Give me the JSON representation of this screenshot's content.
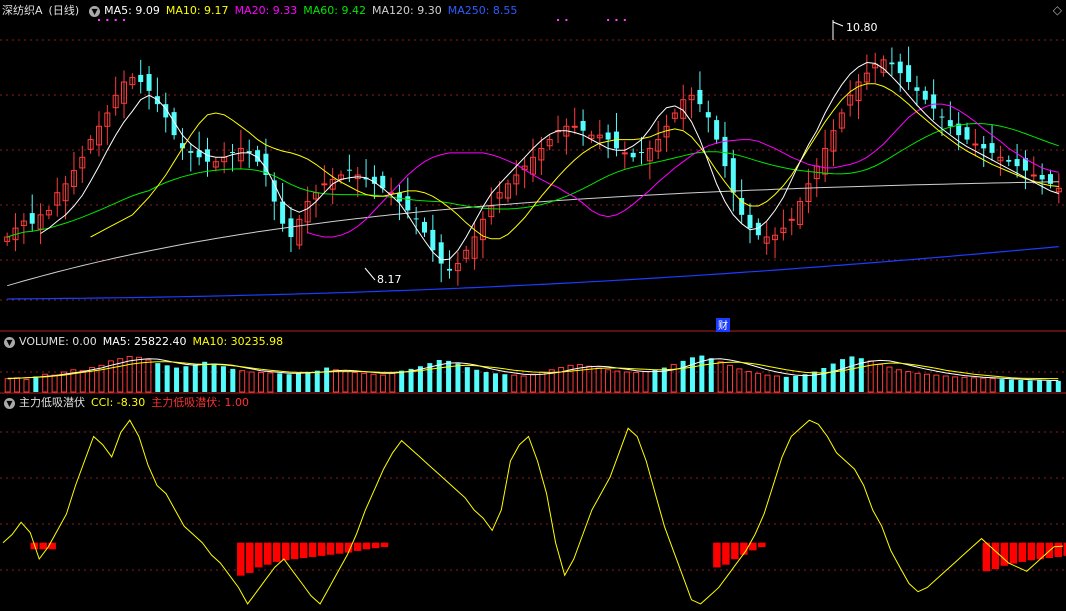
{
  "colors": {
    "up": "#ff3b3b",
    "down": "#54fcfc",
    "ma5": "#ffffff",
    "ma10": "#ffff00",
    "ma20": "#ff00ff",
    "ma60": "#00e600",
    "ma120": "#d0d0d0",
    "ma250": "#1c3cff",
    "cci": "#ffff00",
    "signal": "#ff0000",
    "grid": "#8b1e1e",
    "separator": "#b02020"
  },
  "legend_main": {
    "stock": "深纺织A",
    "period": "(日线)",
    "ma5": "MA5: 9.09",
    "ma10": "MA10: 9.17",
    "ma20": "MA20: 9.33",
    "ma60": "MA60: 9.42",
    "ma120": "MA120: 9.30",
    "ma250": "MA250: 8.55"
  },
  "legend_volume": {
    "name": "VOLUME: 0.00",
    "ma5": "MA5: 25822.40",
    "ma10": "MA10: 30235.98"
  },
  "legend_indicator": {
    "name": "主力低吸潜伏",
    "cci": "CCI: -8.30",
    "signal": "主力低吸潜伏: 1.00"
  },
  "annotations": {
    "high": "10.80",
    "low": "8.17",
    "event": "财"
  },
  "chart_data": [
    {
      "type": "candlestick",
      "panel": "price",
      "title": "深纺织A (日线)",
      "ylim": [
        7.55,
        11.05
      ],
      "close": [
        8.6,
        8.7,
        8.78,
        8.75,
        8.85,
        8.9,
        9.1,
        9.2,
        9.35,
        9.5,
        9.7,
        9.85,
        10.0,
        10.2,
        10.35,
        10.4,
        10.35,
        10.25,
        10.1,
        9.95,
        9.75,
        9.6,
        9.55,
        9.5,
        9.45,
        9.45,
        9.5,
        9.55,
        9.6,
        9.55,
        9.45,
        9.3,
        9.0,
        8.75,
        8.6,
        8.8,
        9.0,
        9.1,
        9.2,
        9.25,
        9.3,
        9.35,
        9.3,
        9.25,
        9.2,
        9.15,
        9.1,
        9.0,
        8.9,
        8.8,
        8.65,
        8.45,
        8.3,
        8.22,
        8.3,
        8.45,
        8.6,
        8.8,
        8.95,
        9.1,
        9.2,
        9.3,
        9.4,
        9.5,
        9.6,
        9.7,
        9.8,
        9.85,
        9.85,
        9.8,
        9.75,
        9.75,
        9.7,
        9.6,
        9.55,
        9.5,
        9.55,
        9.6,
        9.7,
        9.85,
        10.0,
        10.15,
        10.2,
        10.1,
        9.95,
        9.7,
        9.4,
        9.1,
        8.85,
        8.7,
        8.62,
        8.6,
        8.62,
        8.7,
        8.8,
        9.0,
        9.2,
        9.4,
        9.6,
        9.8,
        10.0,
        10.2,
        10.35,
        10.45,
        10.55,
        10.6,
        10.55,
        10.45,
        10.35,
        10.25,
        10.15,
        10.05,
        9.95,
        9.85,
        9.75,
        9.7,
        9.65,
        9.6,
        9.55,
        9.5,
        9.45,
        9.4,
        9.35,
        9.3,
        9.25,
        9.2,
        9.15
      ],
      "ma": {
        "ma5": [
          8.64,
          8.7,
          8.78,
          8.85,
          8.95,
          9.07,
          9.23,
          9.4,
          9.58,
          9.75,
          9.9,
          10.02,
          10.15,
          10.2,
          10.15,
          10.05,
          9.9,
          9.75,
          9.65,
          9.58,
          9.52,
          9.5,
          9.5,
          9.53,
          9.55,
          9.55,
          9.5,
          9.38,
          9.2,
          9.0,
          8.92,
          8.88,
          8.92,
          9.0,
          9.1,
          9.2,
          9.25,
          9.27,
          9.28,
          9.27,
          9.22,
          9.15,
          9.07,
          8.98,
          8.85,
          8.7,
          8.56,
          8.43,
          8.34,
          8.35,
          8.45,
          8.6,
          8.77,
          8.94,
          9.09,
          9.2,
          9.3,
          9.4,
          9.5,
          9.6,
          9.69,
          9.76,
          9.8,
          9.8,
          9.78,
          9.75,
          9.7,
          9.65,
          9.6,
          9.58,
          9.58,
          9.63,
          9.7,
          9.82,
          9.96,
          10.06,
          10.08,
          10.03,
          9.9,
          9.7,
          9.45,
          9.2,
          9.0,
          8.85,
          8.75,
          8.68,
          8.7,
          8.78,
          8.9,
          9.05,
          9.25,
          9.45,
          9.64,
          9.8,
          10.0,
          10.17,
          10.32,
          10.44,
          10.52,
          10.57,
          10.56,
          10.5,
          10.41,
          10.31,
          10.2,
          10.09,
          9.99,
          9.9,
          9.82,
          9.75,
          9.68,
          9.62,
          9.57,
          9.52,
          9.47,
          9.42,
          9.37,
          9.32,
          9.27,
          9.22,
          9.17,
          9.12,
          9.09
        ],
        "ma10": [
          8.6,
          8.65,
          8.7,
          8.75,
          8.8,
          8.85,
          8.95,
          9.05,
          9.17,
          9.3,
          9.45,
          9.6,
          9.75,
          9.88,
          9.98,
          10.0,
          9.98,
          9.92,
          9.85,
          9.78,
          9.7,
          9.64,
          9.6,
          9.57,
          9.55,
          9.52,
          9.48,
          9.42,
          9.35,
          9.28,
          9.22,
          9.17,
          9.12,
          9.08,
          9.06,
          9.06,
          9.08,
          9.1,
          9.12,
          9.12,
          9.1,
          9.06,
          9.0,
          8.93,
          8.85,
          8.76,
          8.68,
          8.61,
          8.58,
          8.58,
          8.63,
          8.72,
          8.82,
          8.94,
          9.06,
          9.17,
          9.28,
          9.38,
          9.47,
          9.55,
          9.61,
          9.66,
          9.68,
          9.7,
          9.7,
          9.7,
          9.71,
          9.73,
          9.77,
          9.8,
          9.82,
          9.8,
          9.73,
          9.62,
          9.49,
          9.35,
          9.22,
          9.1,
          9.0,
          8.95,
          8.95,
          9.0,
          9.08,
          9.18,
          9.3,
          9.45,
          9.6,
          9.75,
          9.9,
          10.03,
          10.15,
          10.24,
          10.3,
          10.33,
          10.33,
          10.3,
          10.25,
          10.18,
          10.1,
          10.01,
          9.93,
          9.85,
          9.77,
          9.7,
          9.63,
          9.57,
          9.52,
          9.47,
          9.42,
          9.38,
          9.34,
          9.3,
          9.26,
          9.23,
          9.2,
          9.18,
          9.17
        ],
        "ma20": [
          8.65,
          8.62,
          8.6,
          8.6,
          8.62,
          8.66,
          8.72,
          8.8,
          8.9,
          9.0,
          9.1,
          9.2,
          9.3,
          9.38,
          9.45,
          9.5,
          9.53,
          9.55,
          9.55,
          9.55,
          9.55,
          9.55,
          9.53,
          9.5,
          9.46,
          9.42,
          9.36,
          9.3,
          9.25,
          9.2,
          9.16,
          9.1,
          9.05,
          8.98,
          8.9,
          8.85,
          8.83,
          8.85,
          8.9,
          8.97,
          9.05,
          9.13,
          9.22,
          9.3,
          9.38,
          9.45,
          9.52,
          9.58,
          9.63,
          9.66,
          9.68,
          9.69,
          9.7,
          9.7,
          9.68,
          9.64,
          9.6,
          9.55,
          9.5,
          9.46,
          9.42,
          9.4,
          9.38,
          9.38,
          9.4,
          9.42,
          9.45,
          9.5,
          9.57,
          9.65,
          9.75,
          9.85,
          9.95,
          10.02,
          10.07,
          10.1,
          10.1,
          10.08,
          10.03,
          9.97,
          9.9,
          9.82,
          9.75,
          9.68,
          9.6,
          9.54,
          9.48,
          9.43,
          9.38,
          9.35,
          9.33
        ]
      }
    },
    {
      "type": "bar",
      "panel": "volume",
      "title": "VOLUME",
      "values": [
        30,
        32,
        28,
        35,
        40,
        38,
        45,
        50,
        48,
        55,
        60,
        70,
        75,
        80,
        78,
        72,
        65,
        60,
        55,
        58,
        62,
        68,
        64,
        58,
        52,
        48,
        45,
        44,
        43,
        42,
        40,
        42,
        45,
        48,
        55,
        50,
        46,
        44,
        42,
        40,
        38,
        42,
        48,
        52,
        58,
        65,
        72,
        70,
        64,
        56,
        50,
        45,
        42,
        40,
        38,
        36,
        40,
        45,
        50,
        55,
        60,
        62,
        58,
        54,
        50,
        47,
        45,
        44,
        46,
        50,
        55,
        62,
        70,
        78,
        82,
        76,
        68,
        60,
        52,
        46,
        42,
        38,
        36,
        34,
        36,
        40,
        46,
        54,
        64,
        74,
        80,
        76,
        70,
        62,
        56,
        50,
        46,
        42,
        40,
        38,
        36,
        34,
        33,
        32,
        31,
        30,
        29,
        28,
        27,
        26,
        26,
        25,
        25
      ],
      "ma5": [
        30,
        31,
        32,
        33,
        35,
        37,
        40,
        43,
        46,
        50,
        54,
        60,
        65,
        70,
        73,
        75,
        74,
        70,
        66,
        62,
        60,
        62,
        63,
        62,
        60,
        56,
        52,
        48,
        46,
        44,
        42,
        42,
        43,
        44,
        46,
        48,
        49,
        48,
        46,
        44,
        42,
        42,
        44,
        47,
        51,
        56,
        61,
        65,
        66,
        64,
        60,
        55,
        50,
        46,
        43,
        40,
        39,
        40,
        42,
        45,
        50,
        54,
        57,
        58,
        57,
        54,
        51,
        48,
        46,
        46,
        47,
        50,
        55,
        62,
        69,
        74,
        75,
        72,
        68,
        62,
        56,
        50,
        45,
        41,
        38,
        37,
        38,
        41,
        46,
        52,
        59,
        65,
        69,
        71,
        70,
        66,
        61,
        56,
        51,
        47,
        43,
        40,
        37,
        35,
        33,
        32,
        31,
        30,
        29,
        28,
        27,
        26,
        25.8
      ],
      "ma10": [
        31,
        31,
        32,
        33,
        34,
        36,
        38,
        41,
        44,
        47,
        50,
        54,
        58,
        62,
        65,
        67,
        68,
        68,
        67,
        65,
        63,
        62,
        62,
        61,
        59,
        57,
        54,
        51,
        49,
        47,
        45,
        44,
        44,
        44,
        45,
        46,
        46,
        46,
        46,
        45,
        44,
        44,
        45,
        46,
        48,
        51,
        54,
        57,
        59,
        60,
        59,
        57,
        55,
        52,
        49,
        47,
        45,
        44,
        44,
        45,
        47,
        49,
        51,
        53,
        54,
        54,
        53,
        52,
        51,
        50,
        50,
        51,
        53,
        56,
        60,
        63,
        66,
        67,
        67,
        65,
        62,
        58,
        54,
        50,
        47,
        44,
        43,
        43,
        45,
        48,
        52,
        56,
        60,
        63,
        65,
        65,
        63,
        60,
        57,
        53,
        49,
        46,
        43,
        40,
        38,
        36,
        34,
        32,
        31,
        30.5,
        30.3,
        30.2,
        30.2
      ]
    },
    {
      "type": "line",
      "panel": "indicator",
      "title": "主力低吸潜伏",
      "ylim": [
        -160,
        320
      ],
      "series": [
        {
          "name": "CCI",
          "values": [
            0,
            20,
            50,
            25,
            -40,
            -10,
            30,
            70,
            140,
            200,
            260,
            240,
            210,
            270,
            300,
            260,
            190,
            140,
            120,
            80,
            40,
            20,
            0,
            -30,
            -50,
            -80,
            -110,
            -150,
            -120,
            -90,
            -60,
            -40,
            -70,
            -100,
            -130,
            -150,
            -110,
            -70,
            -30,
            20,
            80,
            130,
            180,
            220,
            250,
            230,
            210,
            190,
            170,
            150,
            130,
            110,
            80,
            60,
            30,
            80,
            200,
            240,
            260,
            200,
            120,
            0,
            -80,
            -40,
            20,
            80,
            120,
            160,
            220,
            280,
            260,
            200,
            120,
            40,
            -20,
            -80,
            -140,
            -150,
            -130,
            -110,
            -80,
            -50,
            -20,
            20,
            70,
            140,
            210,
            260,
            280,
            300,
            290,
            260,
            220,
            200,
            180,
            140,
            80,
            40,
            -20,
            -60,
            -100,
            -120,
            -110,
            -90,
            -70,
            -50,
            -30,
            -10,
            10,
            -10,
            -30,
            -50,
            -60,
            -70,
            -50,
            -30,
            -10,
            -8.3
          ],
          "color": "#ffff00"
        },
        {
          "name": "主力低吸潜伏",
          "type": "bar",
          "bars": [
            [
              3,
              12
            ],
            [
              4,
              12
            ],
            [
              5,
              12
            ],
            [
              26,
              60
            ],
            [
              27,
              55
            ],
            [
              28,
              45
            ],
            [
              29,
              40
            ],
            [
              30,
              35
            ],
            [
              31,
              32
            ],
            [
              32,
              30
            ],
            [
              33,
              28
            ],
            [
              34,
              26
            ],
            [
              35,
              24
            ],
            [
              36,
              22
            ],
            [
              37,
              20
            ],
            [
              38,
              18
            ],
            [
              39,
              15
            ],
            [
              40,
              12
            ],
            [
              41,
              10
            ],
            [
              42,
              8
            ],
            [
              79,
              45
            ],
            [
              80,
              40
            ],
            [
              81,
              30
            ],
            [
              82,
              22
            ],
            [
              83,
              14
            ],
            [
              84,
              8
            ],
            [
              109,
              52
            ],
            [
              110,
              48
            ],
            [
              111,
              42
            ],
            [
              112,
              38
            ],
            [
              113,
              35
            ],
            [
              114,
              32
            ],
            [
              115,
              30
            ],
            [
              116,
              28
            ],
            [
              117,
              26
            ],
            [
              118,
              24
            ],
            [
              119,
              22
            ],
            [
              120,
              20
            ],
            [
              121,
              18
            ],
            [
              122,
              16
            ],
            [
              123,
              15
            ]
          ],
          "color": "#ff0000"
        }
      ]
    }
  ]
}
